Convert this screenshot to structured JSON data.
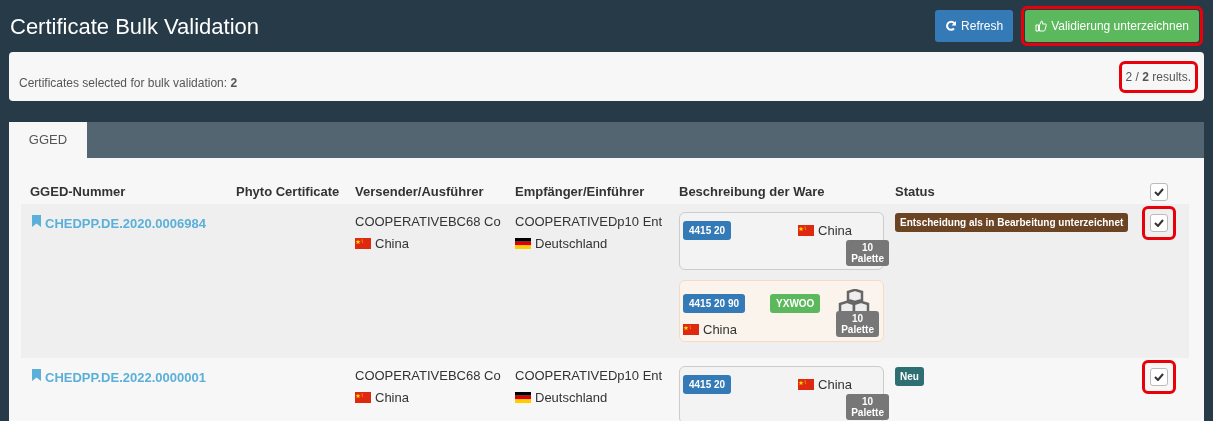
{
  "title": "Certificate Bulk Validation",
  "buttons": [
    {
      "kind": "refresh",
      "label": "Refresh",
      "highlighted": false
    },
    {
      "kind": "sign",
      "label": "Validierung unterzeichnen",
      "highlighted": true
    }
  ],
  "summary": {
    "text": "Certificates selected for bulk validation: **2**",
    "results": "2 / **2** results.",
    "highlighted": true
  },
  "tabs": [
    {
      "label": "GGED",
      "selected": true
    }
  ],
  "table": {
    "columns": [
      "GGED-Nummer",
      "Phyto Certificate",
      "Versender/Ausführer",
      "Empfänger/Einführer",
      "Beschreibung der Ware",
      "Status"
    ],
    "select_all": {
      "checked": true
    },
    "rows": [
      {
        "number": "CHEDPP.DE.2020.0006984",
        "sender": {
          "name": "COOPERATIVEBC68 Co",
          "country": "China",
          "flag": {
            "kind": "cn"
          }
        },
        "receiver": {
          "name": "COOPERATIVEDp10 Ent",
          "country": "Deutschland",
          "flag": {
            "kind": "de"
          }
        },
        "goods": [
          {
            "kind": "plain",
            "code": "4415 20",
            "country": "China",
            "flag": {
              "kind": "cn"
            },
            "quantity": "10",
            "unit": "Palette"
          },
          {
            "kind": "packaged",
            "code": "4415 20 90",
            "tag": "YXWOO",
            "country": "China",
            "flag": {
              "kind": "cn"
            },
            "quantity": "10",
            "unit": "Palette"
          }
        ],
        "status": {
          "label": "Entscheidung als in Bearbeitung unterzeichnet",
          "color": "#6b4423"
        },
        "checked": true,
        "highlighted": true
      },
      {
        "number": "CHEDPP.DE.2022.0000001",
        "sender": {
          "name": "COOPERATIVEBC68 Co",
          "country": "China",
          "flag": {
            "kind": "cn"
          }
        },
        "receiver": {
          "name": "COOPERATIVEDp10 Ent",
          "country": "Deutschland",
          "flag": {
            "kind": "de"
          }
        },
        "goods": [
          {
            "kind": "plain",
            "code": "4415 20",
            "country": "China",
            "flag": {
              "kind": "cn"
            },
            "quantity": "10",
            "unit": "Palette"
          }
        ],
        "status": {
          "label": "Neu",
          "color": "#2d6f73"
        },
        "checked": true,
        "highlighted": true
      }
    ]
  }
}
